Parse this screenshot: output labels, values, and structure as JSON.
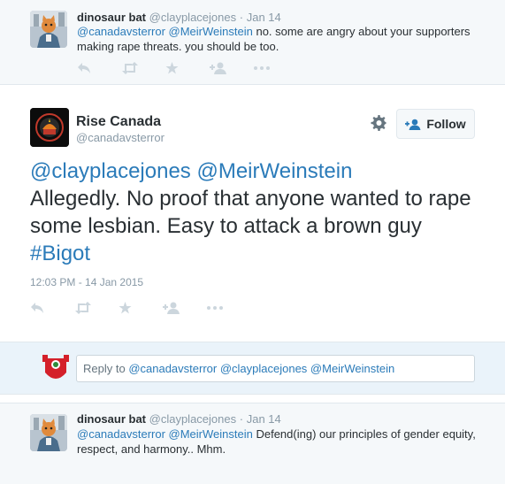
{
  "top_tweet": {
    "name": "dinosaur bat",
    "handle": "@clayplacejones",
    "sep": "·",
    "time": "Jan 14",
    "mention1": "@canadavsterror",
    "mention2": "@MeirWeinstein",
    "text": " no. some are angry about your supporters making rape threats. you should be too."
  },
  "main_tweet": {
    "name": "Rise Canada",
    "handle": "@canadavsterror",
    "follow_label": "Follow",
    "mention1": "@clayplacejones",
    "mention2": "@MeirWeinstein",
    "body": "Allegedly. No proof that anyone wanted to rape some lesbian. Easy to attack a brown guy ",
    "hashtag": "#Bigot",
    "timestamp": "12:03 PM - 14 Jan 2015"
  },
  "reply_box": {
    "prefix": "Reply to ",
    "value": "@canadavsterror @clayplacejones @MeirWeinstein"
  },
  "bottom_tweet": {
    "name": "dinosaur bat",
    "handle": "@clayplacejones",
    "sep": "·",
    "time": "Jan 14",
    "mention1": "@canadavsterror",
    "mention2": "@MeirWeinstein",
    "text": " Defend(ing) our principles of gender equity, respect, and harmony.. Mhm."
  },
  "icons": [
    "reply-icon",
    "retweet-icon",
    "favorite-icon",
    "follow-user-icon",
    "more-icon",
    "gear-icon"
  ],
  "colors": {
    "link": "#2b7bb9",
    "muted": "#8899a6",
    "text": "#292f33",
    "icon": "#ccd6dd"
  }
}
